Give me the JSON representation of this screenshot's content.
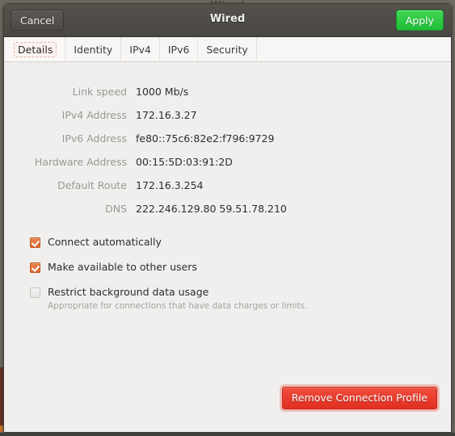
{
  "desktop": {
    "background_title": "Wired"
  },
  "window": {
    "title": "Wired",
    "cancel_label": "Cancel",
    "apply_label": "Apply",
    "accent_green": "#2fc93f",
    "accent_orange": "#dd6a32",
    "accent_red": "#e23221"
  },
  "tabs": [
    {
      "label": "Details",
      "active": true
    },
    {
      "label": "Identity",
      "active": false
    },
    {
      "label": "IPv4",
      "active": false
    },
    {
      "label": "IPv6",
      "active": false
    },
    {
      "label": "Security",
      "active": false
    }
  ],
  "details": [
    {
      "label": "Link speed",
      "value": "1000 Mb/s"
    },
    {
      "label": "IPv4 Address",
      "value": "172.16.3.27"
    },
    {
      "label": "IPv6 Address",
      "value": "fe80::75c6:82e2:f796:9729"
    },
    {
      "label": "Hardware Address",
      "value": "00:15:5D:03:91:2D"
    },
    {
      "label": "Default Route",
      "value": "172.16.3.254"
    },
    {
      "label": "DNS",
      "value": "222.246.129.80 59.51.78.210"
    }
  ],
  "options": [
    {
      "label": "Connect automatically",
      "checked": true,
      "sub": ""
    },
    {
      "label": "Make available to other users",
      "checked": true,
      "sub": ""
    },
    {
      "label": "Restrict background data usage",
      "checked": false,
      "sub": "Appropriate for connections that have data charges or limits."
    }
  ],
  "actions": {
    "remove_label": "Remove Connection Profile"
  }
}
